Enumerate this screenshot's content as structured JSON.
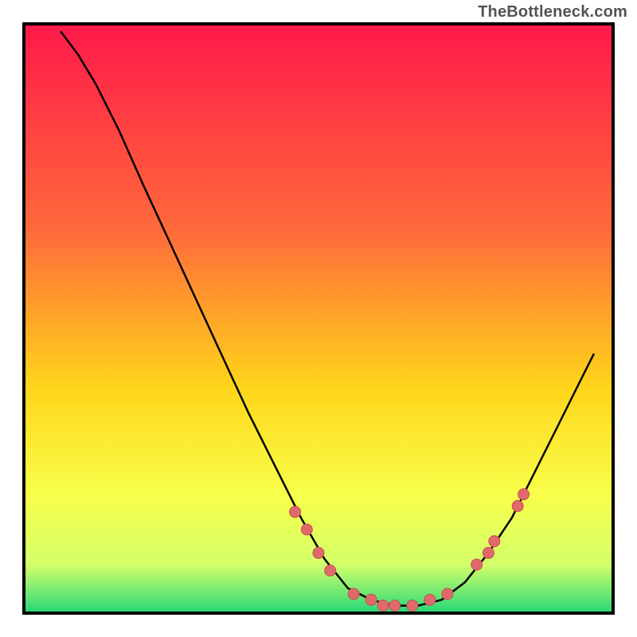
{
  "watermark": "TheBottleneck.com",
  "colors": {
    "gradient_top": "#ff1a4a",
    "gradient_mid1": "#ff6a3a",
    "gradient_mid2": "#ffd61a",
    "gradient_mid3": "#f7ff4a",
    "gradient_mid4": "#d4ff6a",
    "gradient_bottom": "#2bd978",
    "curve": "#000000",
    "point_fill": "#e06a6a",
    "point_stroke": "#c94f4f"
  },
  "chart_data": {
    "type": "line",
    "title": "",
    "xlabel": "",
    "ylabel": "",
    "xlim": [
      0,
      100
    ],
    "ylim": [
      0,
      100
    ],
    "curve": [
      {
        "x": 6,
        "y": 99
      },
      {
        "x": 9,
        "y": 95
      },
      {
        "x": 12,
        "y": 90
      },
      {
        "x": 16,
        "y": 82
      },
      {
        "x": 20,
        "y": 73
      },
      {
        "x": 26,
        "y": 60
      },
      {
        "x": 32,
        "y": 47
      },
      {
        "x": 38,
        "y": 34
      },
      {
        "x": 43,
        "y": 24
      },
      {
        "x": 47,
        "y": 16
      },
      {
        "x": 51,
        "y": 9
      },
      {
        "x": 55,
        "y": 4
      },
      {
        "x": 59,
        "y": 2
      },
      {
        "x": 63,
        "y": 1
      },
      {
        "x": 67,
        "y": 1
      },
      {
        "x": 71,
        "y": 2
      },
      {
        "x": 75,
        "y": 5
      },
      {
        "x": 79,
        "y": 10
      },
      {
        "x": 83,
        "y": 16
      },
      {
        "x": 87,
        "y": 24
      },
      {
        "x": 91,
        "y": 32
      },
      {
        "x": 94,
        "y": 38
      },
      {
        "x": 97,
        "y": 44
      }
    ],
    "points": [
      {
        "x": 46,
        "y": 17
      },
      {
        "x": 48,
        "y": 14
      },
      {
        "x": 50,
        "y": 10
      },
      {
        "x": 52,
        "y": 7
      },
      {
        "x": 56,
        "y": 3
      },
      {
        "x": 59,
        "y": 2
      },
      {
        "x": 61,
        "y": 1
      },
      {
        "x": 63,
        "y": 1
      },
      {
        "x": 66,
        "y": 1
      },
      {
        "x": 69,
        "y": 2
      },
      {
        "x": 72,
        "y": 3
      },
      {
        "x": 77,
        "y": 8
      },
      {
        "x": 79,
        "y": 10
      },
      {
        "x": 80,
        "y": 12
      },
      {
        "x": 84,
        "y": 18
      },
      {
        "x": 85,
        "y": 20
      }
    ]
  }
}
